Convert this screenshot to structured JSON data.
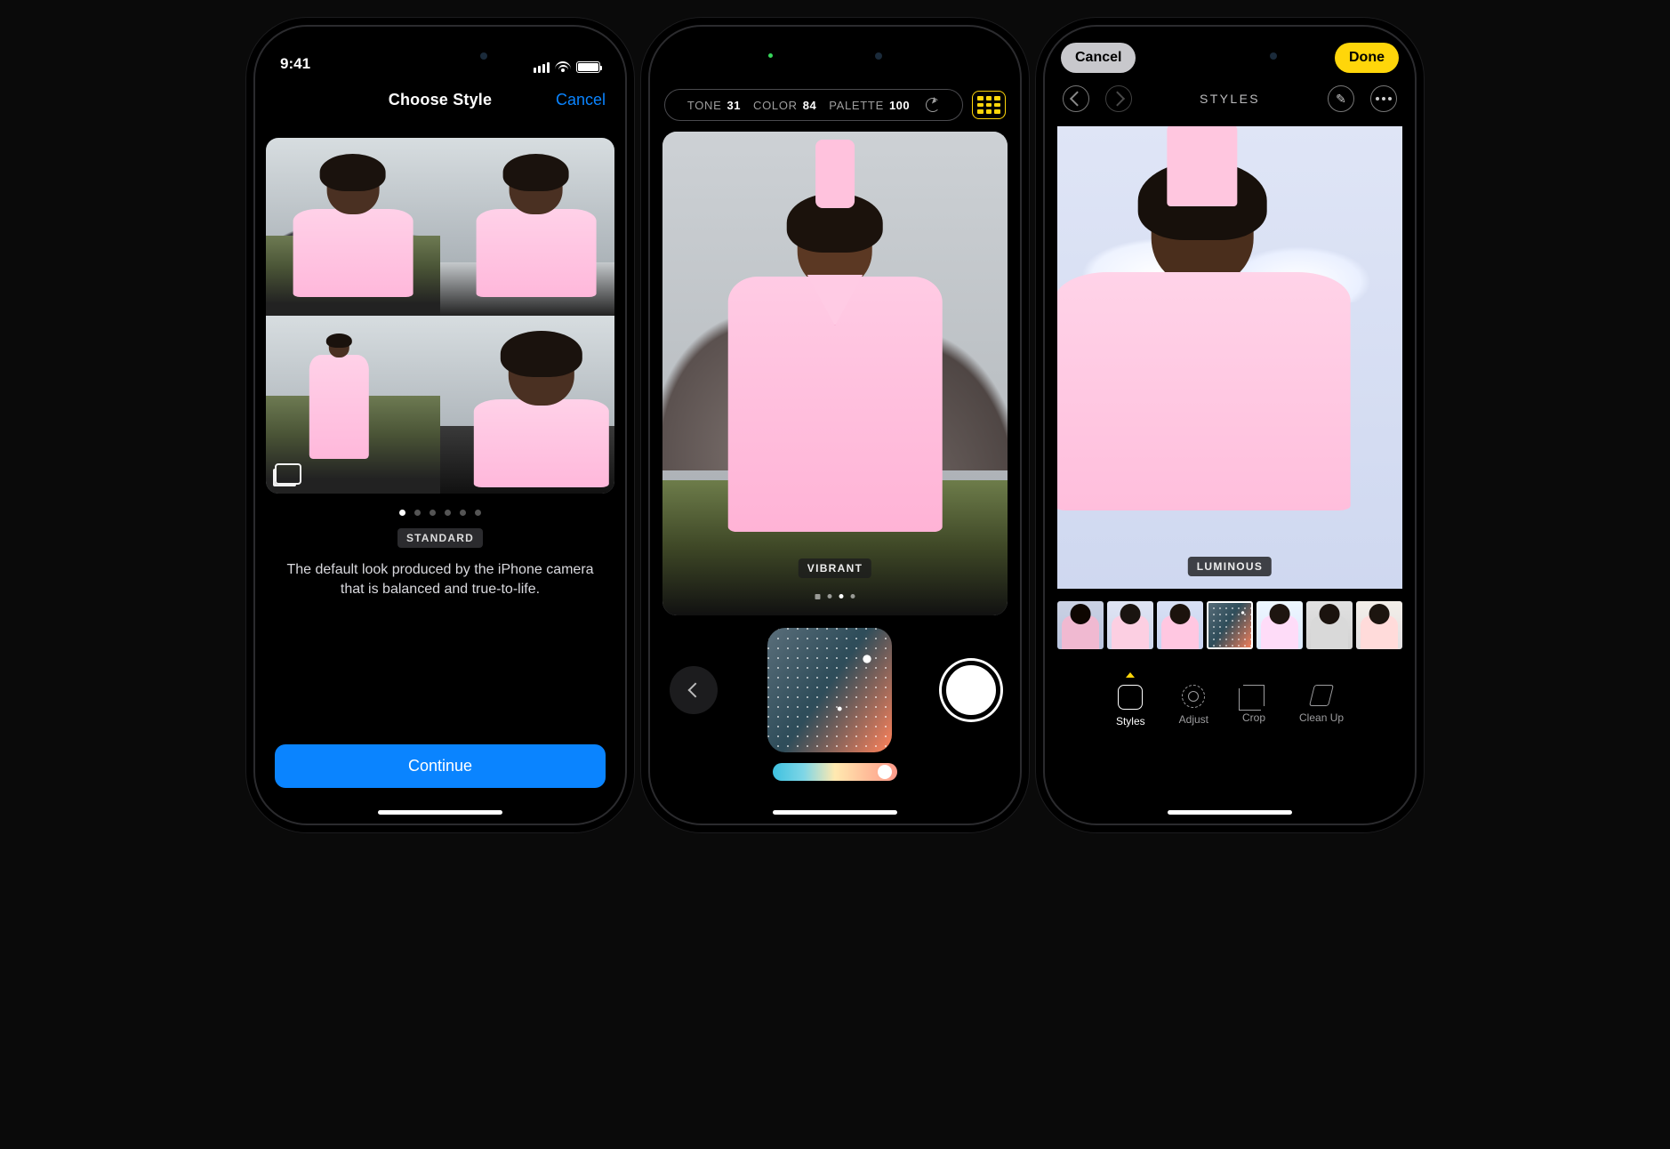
{
  "phone1": {
    "status_time": "9:41",
    "header_title": "Choose Style",
    "cancel_label": "Cancel",
    "pager_count": 6,
    "pager_active_index": 0,
    "style_name": "STANDARD",
    "style_description": "The default look produced by the iPhone camera that is balanced and true-to-life.",
    "continue_label": "Continue"
  },
  "phone2": {
    "params": {
      "tone_label": "TONE",
      "tone_value": "31",
      "color_label": "COLOR",
      "color_value": "84",
      "palette_label": "PALETTE",
      "palette_value": "100"
    },
    "style_name": "VIBRANT",
    "pager_count": 4,
    "pager_active_index": 2
  },
  "phone3": {
    "cancel_label": "Cancel",
    "done_label": "Done",
    "section_title": "STYLES",
    "style_name": "LUMINOUS",
    "tools": {
      "styles": "Styles",
      "adjust": "Adjust",
      "crop": "Crop",
      "cleanup": "Clean Up"
    }
  }
}
